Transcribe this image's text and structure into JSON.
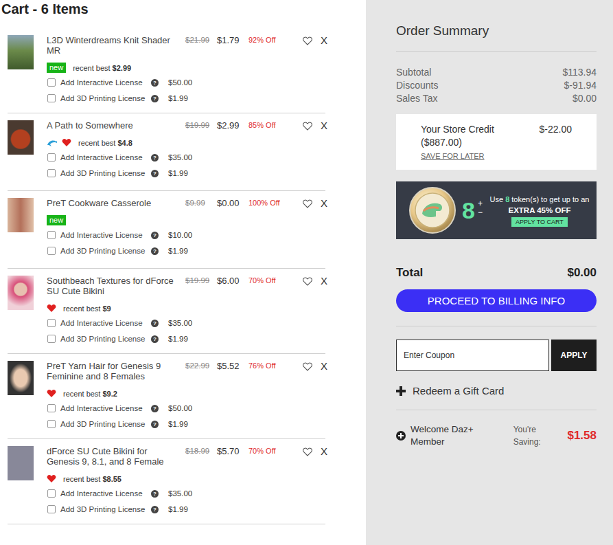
{
  "cart": {
    "title": "Cart - 6 Items",
    "items": [
      {
        "name": "L3D Winterdreams Knit Shader MR",
        "original_price": "$21.99",
        "price": "$1.79",
        "discount": "92% Off",
        "badge": "new",
        "icons": [],
        "recent_best": {
          "label": "recent best",
          "value": "$2.99"
        },
        "wishlisted": false,
        "remove": "X",
        "licenses": [
          {
            "label": "Add Interactive License",
            "help": "?",
            "price": "$50.00",
            "checked": false
          },
          {
            "label": "Add 3D Printing License",
            "help": "?",
            "price": "$1.99",
            "checked": false
          }
        ]
      },
      {
        "name": "A Path to Somewhere",
        "original_price": "$19.99",
        "price": "$2.99",
        "discount": "85% Off",
        "icons": [
          {
            "kind": "dolphin"
          },
          {
            "kind": "heart"
          }
        ],
        "recent_best": {
          "label": "recent best",
          "value": "$4.8"
        },
        "wishlisted": false,
        "remove": "X",
        "licenses": [
          {
            "label": "Add Interactive License",
            "help": "?",
            "price": "$35.00",
            "checked": false
          },
          {
            "label": "Add 3D Printing License",
            "help": "?",
            "price": "$1.99",
            "checked": false
          }
        ]
      },
      {
        "name": "PreT Cookware Casserole",
        "original_price": "$9.99",
        "price": "$0.00",
        "discount": "100% Off",
        "badge": "new",
        "icons": [],
        "wishlisted": false,
        "remove": "X",
        "licenses": [
          {
            "label": "Add Interactive License",
            "help": "?",
            "price": "$10.00",
            "checked": false
          },
          {
            "label": "Add 3D Printing License",
            "help": "?",
            "price": "$1.99",
            "checked": false
          }
        ]
      },
      {
        "name": "Southbeach Textures for dForce SU Cute Bikini",
        "original_price": "$19.99",
        "price": "$6.00",
        "discount": "70% Off",
        "icons": [
          {
            "kind": "heart"
          }
        ],
        "recent_best": {
          "label": "recent best",
          "value": "$9"
        },
        "wishlisted": false,
        "remove": "X",
        "licenses": [
          {
            "label": "Add Interactive License",
            "help": "?",
            "price": "$35.00",
            "checked": false
          },
          {
            "label": "Add 3D Printing License",
            "help": "?",
            "price": "$1.99",
            "checked": false
          }
        ]
      },
      {
        "name": "PreT Yarn Hair for Genesis 9 Feminine and 8 Females",
        "original_price": "$22.99",
        "price": "$5.52",
        "discount": "76% Off",
        "icons": [
          {
            "kind": "heart"
          }
        ],
        "recent_best": {
          "label": "recent best",
          "value": "$9.2"
        },
        "wishlisted": false,
        "remove": "X",
        "licenses": [
          {
            "label": "Add Interactive License",
            "help": "?",
            "price": "$50.00",
            "checked": false
          },
          {
            "label": "Add 3D Printing License",
            "help": "?",
            "price": "$1.99",
            "checked": false
          }
        ]
      },
      {
        "name": "dForce SU Cute Bikini for Genesis 9, 8.1, and 8 Female",
        "original_price": "$18.99",
        "price": "$5.70",
        "discount": "70% Off",
        "icons": [
          {
            "kind": "heart"
          }
        ],
        "recent_best": {
          "label": "recent best",
          "value": "$8.55"
        },
        "wishlisted": false,
        "remove": "X",
        "licenses": [
          {
            "label": "Add Interactive License",
            "help": "?",
            "price": "$35.00",
            "checked": false
          },
          {
            "label": "Add 3D Printing License",
            "help": "?",
            "price": "$1.99",
            "checked": false
          }
        ]
      }
    ]
  },
  "summary": {
    "title": "Order Summary",
    "rows": [
      {
        "label": "Subtotal",
        "value": "$113.94"
      },
      {
        "label": "Discounts",
        "value": "$-91.94"
      },
      {
        "label": "Sales Tax",
        "value": "$0.00"
      }
    ],
    "store_credit": {
      "label": "Your Store Credit",
      "balance": "($887.00)",
      "value": "$-22.00",
      "link": "SAVE FOR LATER"
    },
    "tokens": {
      "count": "8",
      "plus": "+",
      "minus": "−",
      "pre": "Use ",
      "highlight_count": "8",
      "post": " token(s) to get up to an",
      "offer": "EXTRA 45% OFF",
      "button": "APPLY TO CART"
    },
    "total": {
      "label": "Total",
      "value": "$0.00"
    },
    "proceed": "PROCEED TO BILLING INFO",
    "coupon": {
      "placeholder": "Enter Coupon",
      "button": "APPLY"
    },
    "gift_card": "Redeem a Gift Card",
    "membership": {
      "label": "Welcome Daz+ Member",
      "saving_label": "You're Saving:",
      "saving": "$1.58"
    }
  }
}
